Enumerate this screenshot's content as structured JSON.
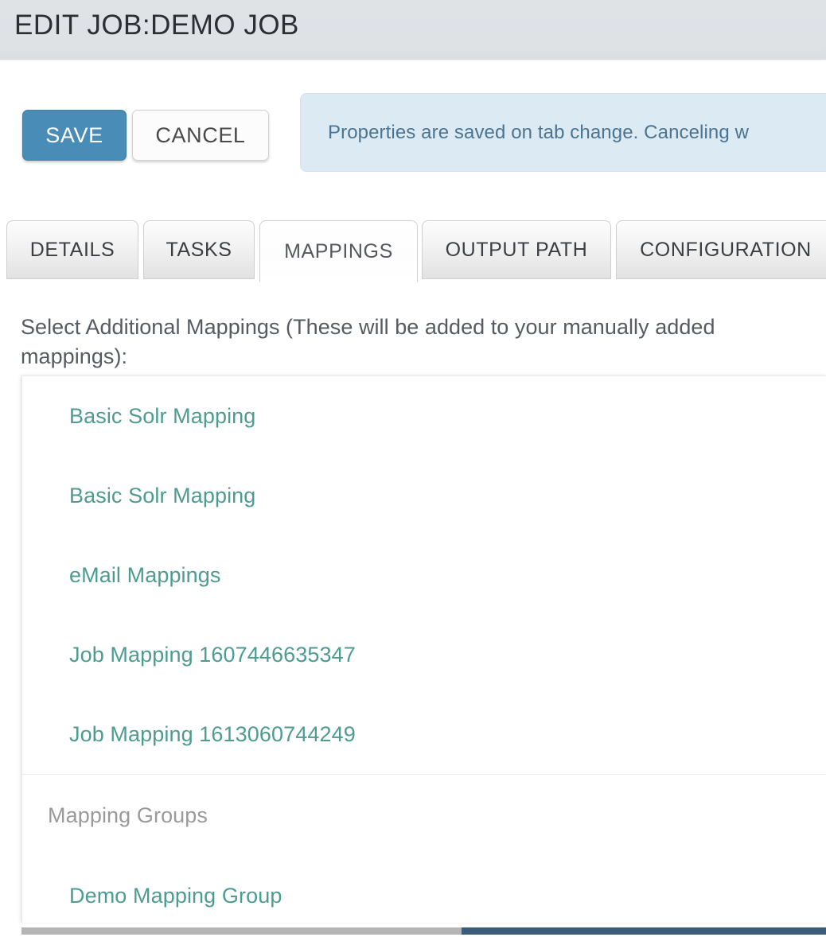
{
  "header": {
    "title": "EDIT JOB:DEMO JOB"
  },
  "toolbar": {
    "save_label": "SAVE",
    "cancel_label": "CANCEL",
    "save_color": "#4a8cb8",
    "info_banner": "Properties are saved on tab change. Canceling w"
  },
  "tabs": [
    {
      "label": "DETAILS",
      "active": false
    },
    {
      "label": "TASKS",
      "active": false
    },
    {
      "label": "MAPPINGS",
      "active": true
    },
    {
      "label": "OUTPUT PATH",
      "active": false
    },
    {
      "label": "CONFIGURATION",
      "active": false
    }
  ],
  "content": {
    "instruction": "Select Additional Mappings (These will be added to your manually added mappings):",
    "link_color": "#4d9c91",
    "mappings": [
      {
        "label": "Basic Solr Mapping"
      },
      {
        "label": "Basic Solr Mapping"
      },
      {
        "label": "eMail Mappings"
      },
      {
        "label": "Job Mapping 1607446635347"
      },
      {
        "label": "Job Mapping 1613060744249"
      }
    ],
    "group_heading": "Mapping Groups",
    "mapping_groups": [
      {
        "label": "Demo Mapping Group"
      }
    ]
  },
  "scrollbar": {
    "thumb_color": "#3b5c78",
    "track_color": "#b5b5b5"
  }
}
